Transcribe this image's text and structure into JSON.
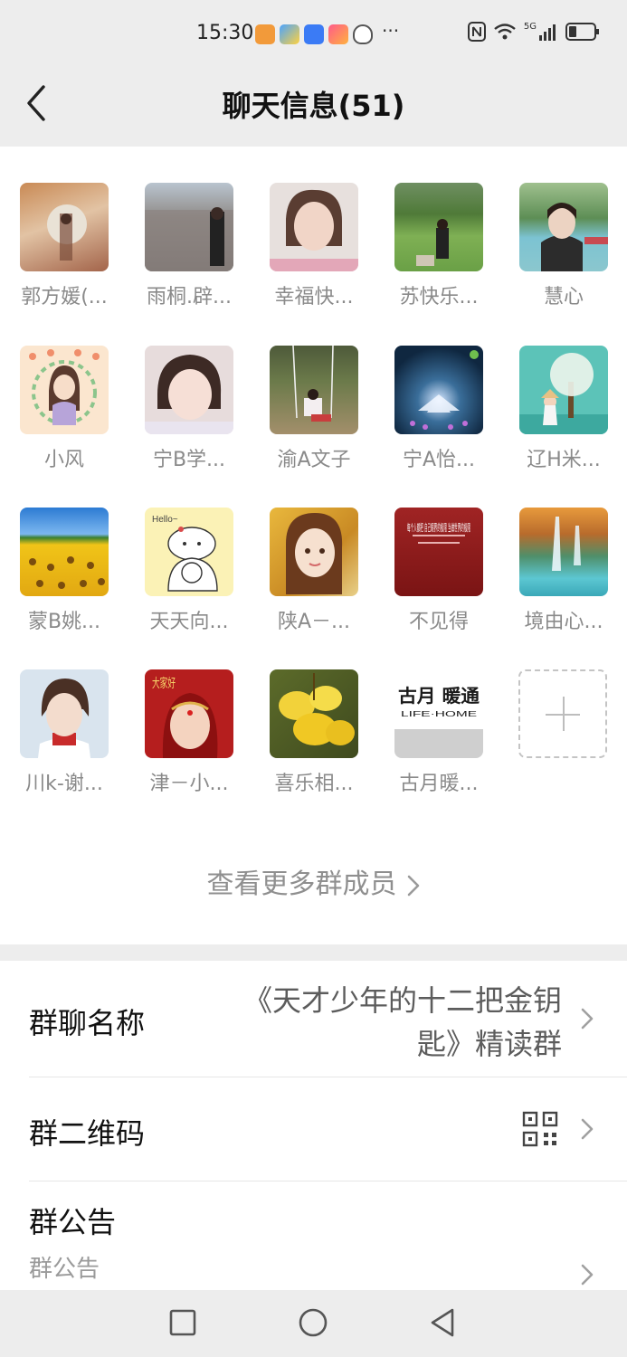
{
  "status_bar": {
    "time": "15:30",
    "more": "···",
    "signal": "5G"
  },
  "nav": {
    "title": "聊天信息(51)"
  },
  "members": [
    {
      "name": "郭方媛(..."
    },
    {
      "name": "雨桐.辟..."
    },
    {
      "name": "幸福快..."
    },
    {
      "name": "苏快乐..."
    },
    {
      "name": "慧心"
    },
    {
      "name": "小风"
    },
    {
      "name": "宁B学..."
    },
    {
      "name": "渝A文子"
    },
    {
      "name": "宁A怡..."
    },
    {
      "name": "辽H米..."
    },
    {
      "name": "蒙B姚..."
    },
    {
      "name": "天天向..."
    },
    {
      "name": "陕A－..."
    },
    {
      "name": "不见得"
    },
    {
      "name": "境由心..."
    },
    {
      "name": "川k-谢..."
    },
    {
      "name": "津－小..."
    },
    {
      "name": "喜乐相..."
    },
    {
      "name": "古月暖..."
    }
  ],
  "avatar_text": {
    "hello": "Hello~",
    "dajiahao": "大家好",
    "brand_cn": "古月 暖通",
    "brand_en": "LIFE·HOME",
    "poster": "每个人都把 自己眼界的极限 当做世界的极限"
  },
  "see_more": "查看更多群成员",
  "settings": {
    "group_name_label": "群聊名称",
    "group_name_value": "《天才少年的十二把金钥匙》精读群",
    "qr_label": "群二维码",
    "notice_label": "群公告",
    "notice_sub": "群公告"
  },
  "colors": {
    "page_bg": "#ededed",
    "card_bg": "#ffffff",
    "muted": "#8a8a8a"
  }
}
